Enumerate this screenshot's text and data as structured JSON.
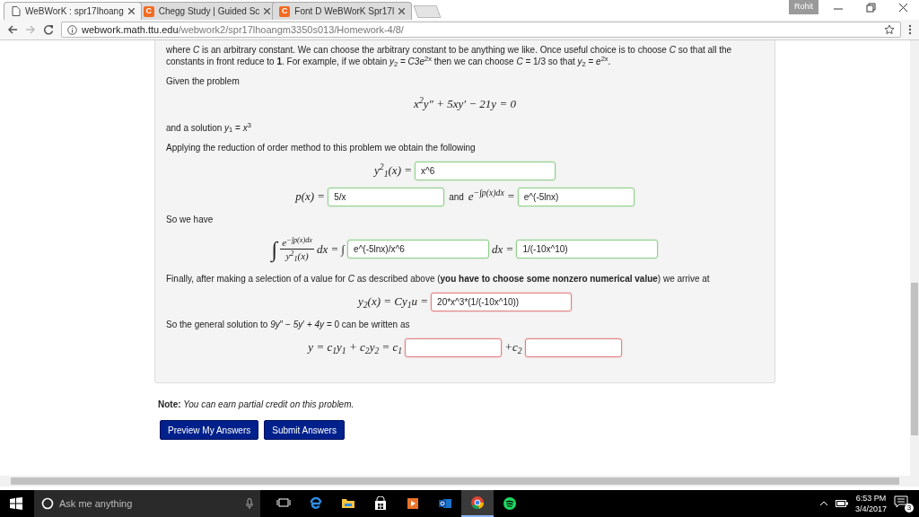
{
  "browser": {
    "tabs": [
      {
        "title": "WeBWorK : spr17lhoang",
        "selected": true
      },
      {
        "title": "Chegg Study | Guided Sc",
        "icon_text": "C",
        "selected": false
      },
      {
        "title": "Font D WeBWorK Spr17l",
        "icon_text": "C",
        "selected": false
      }
    ],
    "profile": "Rohit",
    "address": {
      "host": "webwork.math.ttu.edu",
      "path": "/webwork2/spr17lhoangm3350s013/Homework-4/8/"
    }
  },
  "problem": [
    {
      "kind": "text",
      "text": "where *C* is an arbitrary constant. We can choose the arbitrary constant to be anything we like. Once useful choice is to choose *C* so that all the constants in front reduce to **1**. For example, if we obtain *y*$_{2}$ = *C3e*$^{2x}$ then we can choose *C* = 1/3 so that *y*$_{2}$ = *e*$^{2x}$."
    },
    {
      "kind": "text",
      "text": "Given the problem"
    },
    {
      "kind": "equation",
      "text": "x$^{2}$y″ + 5xy′ − 21y = 0"
    },
    {
      "kind": "text",
      "text": "and a solution *y*$_{1}$ = *x*$^{3}$"
    },
    {
      "kind": "text",
      "text": "Applying the reduction of order method to this problem we obtain the following"
    },
    {
      "kind": "answers",
      "parts": [
        {
          "kind": "math",
          "text": "y$^{2}$$_{1}$(x) ="
        },
        {
          "kind": "field",
          "value": "x^6",
          "correct": true
        }
      ]
    },
    {
      "kind": "answers",
      "parts": [
        {
          "kind": "math",
          "text": "p(x) ="
        },
        {
          "kind": "field",
          "value": "5/x",
          "correct": true
        },
        {
          "kind": "label",
          "text": "and"
        },
        {
          "kind": "math",
          "text": "e$^{−∫p(x)dx}$ ="
        },
        {
          "kind": "field",
          "value": "e^(-5lnx)",
          "correct": true
        }
      ]
    },
    {
      "kind": "text",
      "text": "So we have"
    },
    {
      "kind": "answers",
      "parts": [
        {
          "kind": "integral",
          "text": "∫"
        },
        {
          "kind": "fraction",
          "numerator": "e$^{−∫p(x)dx}$",
          "denominator": "y$^{2}$$_{1}$(x)"
        },
        {
          "kind": "math",
          "text": "dx = ∫"
        },
        {
          "kind": "field",
          "value": "e^(-5lnx)/x^6",
          "correct": true
        },
        {
          "kind": "math",
          "text": "dx ="
        },
        {
          "kind": "field",
          "value": "1/(-10x^10)",
          "correct": true
        }
      ]
    },
    {
      "kind": "text",
      "text": "Finally, after making a selection of a value for *C* as described above (**you have to choose some nonzero numerical value**) we arrive at"
    },
    {
      "kind": "answers",
      "parts": [
        {
          "kind": "math",
          "text": "y$_{2}$(x) = Cy$_{1}$u ="
        },
        {
          "kind": "field",
          "value": "20*x^3*(1/(-10x^10))",
          "correct": false
        }
      ]
    },
    {
      "kind": "text",
      "text": "So the general solution to *9y*″ − *5y*′ + *4y* = 0 can be written as"
    },
    {
      "kind": "answers",
      "parts": [
        {
          "kind": "math",
          "text": "y = c$_{1}$y$_{1}$ + c$_{2}$y$_{2}$ = c$_{1}$"
        },
        {
          "kind": "field",
          "correct": false
        },
        {
          "kind": "math",
          "text": "+c$_{2}$"
        },
        {
          "kind": "field",
          "correct": false
        }
      ]
    }
  ],
  "note": {
    "label": "Note:",
    "text": "You can earn partial credit on this problem."
  },
  "buttons": [
    "Preview My Answers",
    "Submit Answers"
  ],
  "taskbar": {
    "search_placeholder": "Ask me anything",
    "time": "6:53 PM",
    "date": "3/4/2017",
    "notifications": "3",
    "apps": [
      {
        "kind": "taskview",
        "active": false
      },
      {
        "kind": "edge",
        "active": false
      },
      {
        "kind": "folder",
        "active": false
      },
      {
        "kind": "store",
        "active": false
      },
      {
        "kind": "media",
        "active": false
      },
      {
        "kind": "mail",
        "active": false
      },
      {
        "kind": "chrome",
        "active": true
      },
      {
        "kind": "spotify",
        "active": false
      }
    ]
  }
}
